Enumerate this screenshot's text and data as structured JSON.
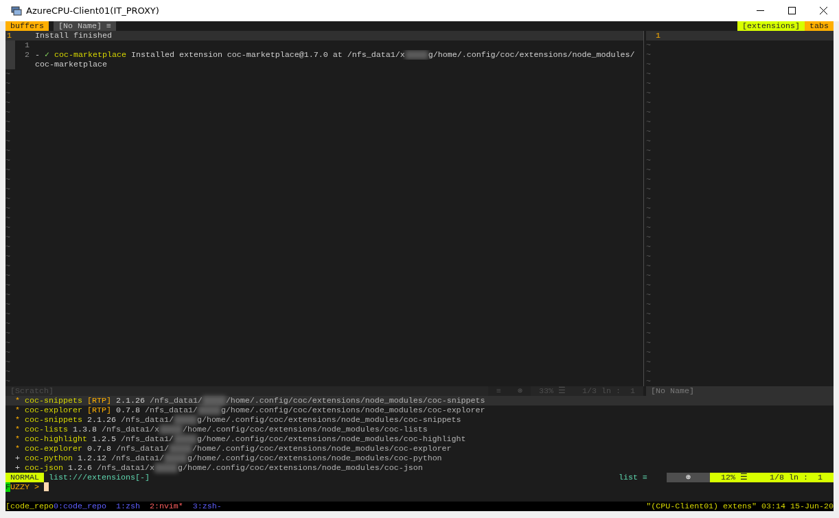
{
  "window": {
    "title": "AzureCPU-Client01(IT_PROXY)"
  },
  "tabline": {
    "left": [
      {
        "label": "buffers",
        "kind": "badge"
      },
      {
        "label": "[No Name]",
        "icon": "≡",
        "kind": "buffer"
      }
    ],
    "right": [
      {
        "label": "[extensions]",
        "kind": "current"
      },
      {
        "label": "tabs",
        "kind": "badge"
      }
    ]
  },
  "left_pane": {
    "lines": [
      {
        "number": "1",
        "text": "Install finished",
        "current": true
      },
      {
        "number": "1",
        "current": false
      }
    ],
    "message": {
      "number": "2",
      "dash": "-",
      "check": "✓",
      "name": "coc-marketplace",
      "text_before": "Installed extension coc-marketplace@1.7.0 at /nfs_data1/x",
      "text_after": "g/home/.config/coc/extensions/node_modules/",
      "continuation": "coc-marketplace"
    },
    "empty_lines": [
      "~",
      "~",
      "~",
      "~",
      "~",
      "~",
      "~",
      "~",
      "~",
      "~",
      "~",
      "~",
      "~",
      "~",
      "~",
      "~",
      "~",
      "~",
      "~",
      "~",
      "~",
      "~",
      "~",
      "~",
      "~",
      "~",
      "~",
      "~",
      "~",
      "~",
      "~",
      "~",
      "~"
    ],
    "status": {
      "name": "[Scratch]",
      "segments": [
        "≡",
        "⊛",
        "33% ☰",
        "1/3 ln :  1"
      ]
    }
  },
  "right_pane": {
    "lines": [
      {
        "number": "1",
        "current": true
      }
    ],
    "empty_lines": [
      "~",
      "~",
      "~",
      "~",
      "~",
      "~",
      "~",
      "~",
      "~",
      "~",
      "~",
      "~",
      "~",
      "~",
      "~",
      "~",
      "~",
      "~",
      "~",
      "~",
      "~",
      "~",
      "~",
      "~",
      "~",
      "~",
      "~",
      "~",
      "~",
      "~",
      "~",
      "~",
      "~",
      "~",
      "~",
      "~"
    ],
    "status": {
      "name": "[No Name]"
    }
  },
  "extensions": [
    {
      "marker": "*",
      "kind": "activated",
      "name": "coc-snippets",
      "tag": "[RTP]",
      "version": "2.1.26",
      "path_start": "/nfs_data1/",
      "path_end": "/home/.config/coc/extensions/node_modules/coc-snippets",
      "selected": true
    },
    {
      "marker": "*",
      "kind": "activated",
      "name": "coc-explorer",
      "tag": "[RTP]",
      "version": "0.7.8",
      "path_start": "/nfs_data1/",
      "path_end": "g/home/.config/coc/extensions/node_modules/coc-explorer",
      "selected": false
    },
    {
      "marker": "*",
      "kind": "activated",
      "name": "coc-snippets",
      "version": "2.1.26",
      "path_start": "/nfs_data1/",
      "path_end": "g/home/.config/coc/extensions/node_modules/coc-snippets",
      "selected": false
    },
    {
      "marker": "*",
      "kind": "activated",
      "name": "coc-lists",
      "version": "1.3.8",
      "path_start": "/nfs_data1/x",
      "path_end": "/home/.config/coc/extensions/node_modules/coc-lists",
      "selected": false
    },
    {
      "marker": "*",
      "kind": "activated",
      "name": "coc-highlight",
      "version": "1.2.5",
      "path_start": "/nfs_data1/",
      "path_end": "g/home/.config/coc/extensions/node_modules/coc-highlight",
      "selected": false
    },
    {
      "marker": "*",
      "kind": "activated",
      "name": "coc-explorer",
      "version": "0.7.8",
      "path_start": "/nfs_data1/",
      "path_end": "/home/.config/coc/extensions/node_modules/coc-explorer",
      "selected": false
    },
    {
      "marker": "+",
      "kind": "loaded",
      "name": "coc-python",
      "version": "1.2.12",
      "path_start": "/nfs_data1/",
      "path_end": "g/home/.config/coc/extensions/node_modules/coc-python",
      "selected": false
    },
    {
      "marker": "+",
      "kind": "loaded",
      "name": "coc-json",
      "version": "1.2.6",
      "path_start": "/nfs_data1/x",
      "path_end": "g/home/.config/coc/extensions/node_modules/coc-json",
      "selected": false
    }
  ],
  "list_status": {
    "mode": "NORMAL",
    "uri": "list:///extensions[-]",
    "source": "list ≡",
    "segments": [
      "⊛",
      "12% ☰",
      "1/8 ln :  1"
    ]
  },
  "prompt": {
    "mode": "FUZZY",
    "arrow": ">"
  },
  "tmux": {
    "session": "[code_repo",
    "windows": [
      {
        "label": "0:code_repo",
        "selected": false
      },
      {
        "label": "1:zsh",
        "selected": false
      },
      {
        "label": "2:nvim*",
        "selected": true
      },
      {
        "label": "3:zsh-",
        "selected": false
      }
    ],
    "right": "\"(CPU-Client01) extens\" 03:14 15-Jun-20"
  }
}
